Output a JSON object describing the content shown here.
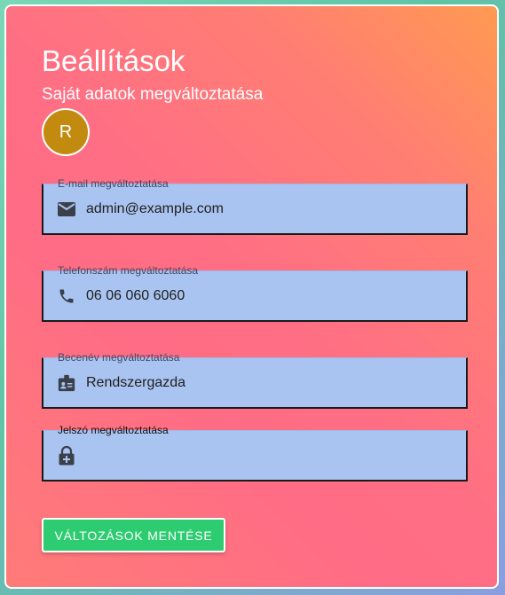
{
  "header": {
    "title": "Beállítások",
    "subtitle": "Saját adatok megváltoztatása"
  },
  "avatar": {
    "initial": "R",
    "color": "#c28a0e"
  },
  "fields": [
    {
      "label": "E-mail megváltoztatása",
      "value": "admin@example.com",
      "icon": "mail-icon"
    },
    {
      "label": "Telefonszám megváltoztatása",
      "value": "06 06 060 6060",
      "icon": "phone-icon"
    },
    {
      "label": "Becenév megváltoztatása",
      "value": "Rendszergazda",
      "icon": "badge-icon"
    },
    {
      "label": "Jelszó megváltoztatása",
      "value": "",
      "icon": "lock-plus-icon"
    }
  ],
  "actions": {
    "save_label": "VÁLTOZÁSOK MENTÉSE"
  },
  "colors": {
    "save_button": "#2ecc71",
    "field_background": "#a9c4f0"
  }
}
